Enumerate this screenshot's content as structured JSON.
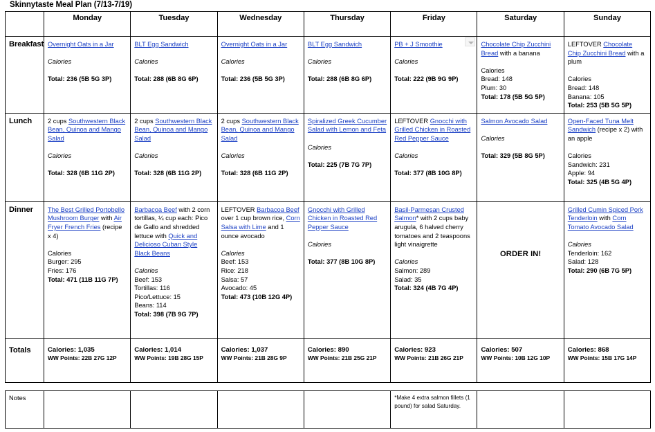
{
  "title": "Skinnytaste Meal Plan (7/13-7/19)",
  "days": [
    "Monday",
    "Tuesday",
    "Wednesday",
    "Thursday",
    "Friday",
    "Saturday",
    "Sunday"
  ],
  "row_labels": {
    "breakfast": "Breakfast",
    "lunch": "Lunch",
    "dinner": "Dinner",
    "totals": "Totals",
    "notes": "Notes"
  },
  "labels": {
    "calories": "Calories",
    "order_in": "ORDER IN!"
  },
  "colors": {
    "link": "#1a3fc4",
    "border": "#000000",
    "background": "#ffffff",
    "icon_gray": "#b4b4b4"
  },
  "icons": {
    "filter_dropdown": "chevron-down-icon"
  },
  "breakfast": {
    "monday": {
      "link": "Overnight Oats in a Jar",
      "after_link": "",
      "calories_label": "Calories",
      "items": [],
      "total": "Total: 236 (5B 5G 3P)"
    },
    "tuesday": {
      "link": "BLT Egg Sandwich",
      "after_link": "",
      "calories_label": "Calories",
      "items": [],
      "total": "Total: 288 (6B 8G 6P)"
    },
    "wednesday": {
      "link": "Overnight Oats in a Jar",
      "after_link": "",
      "calories_label": "Calories",
      "items": [],
      "total": "Total: 236 (5B 5G 3P)"
    },
    "thursday": {
      "link": "BLT Egg Sandwich",
      "after_link": "",
      "calories_label": "Calories",
      "items": [],
      "total": "Total: 288 (6B 8G 6P)"
    },
    "friday": {
      "link": "PB + J Smoothie",
      "after_link": "",
      "calories_label": "Calories",
      "items": [],
      "total": "Total: 222 (9B 9G 9P)"
    },
    "saturday": {
      "link": "Chocolate Chip Zucchini Bread",
      "after_link": " with a banana",
      "calories_label": "Calories",
      "items": [
        "Bread: 148",
        "Plum: 30"
      ],
      "total": "Total: 178 (5B 5G 5P)"
    },
    "sunday": {
      "prefix": "LEFTOVER ",
      "link": "Chocolate Chip Zucchini Bread",
      "after_link": " with a plum",
      "calories_label": "Calories",
      "items": [
        "Bread: 148",
        "Banana: 105"
      ],
      "total": "Total: 253 (5B 5G 5P)"
    }
  },
  "lunch": {
    "monday": {
      "prefix": "2 cups ",
      "link": "Southwestern Black Bean, Quinoa and Mango Salad",
      "after_link": "",
      "calories_label": "Calories",
      "items": [],
      "total": "Total: 328 (6B 11G 2P)"
    },
    "tuesday": {
      "prefix": "2 cups ",
      "link": "Southwestern Black Bean, Quinoa and Mango Salad",
      "after_link": "",
      "calories_label": "Calories",
      "items": [],
      "total": "Total: 328 (6B 11G 2P)"
    },
    "wednesday": {
      "prefix": "2 cups ",
      "link": "Southwestern Black Bean, Quinoa and Mango Salad",
      "after_link": "",
      "calories_label": "Calories",
      "items": [],
      "total": "Total: 328 (6B 11G 2P)"
    },
    "thursday": {
      "prefix": "",
      "link": "Spiralized Greek Cucumber Salad with Lemon and Feta",
      "after_link": "",
      "calories_label": "Calories",
      "items": [],
      "total": "Total: 225 (7B 7G 7P)"
    },
    "friday": {
      "prefix": "LEFTOVER ",
      "link": "Gnocchi with Grilled Chicken in Roasted Red Pepper Sauce",
      "after_link": "",
      "calories_label": "Calories",
      "items": [],
      "total": "Total: 377 (8B 10G 8P)"
    },
    "saturday": {
      "prefix": "",
      "link": "Salmon Avocado Salad",
      "after_link": "",
      "calories_label": "Calories",
      "items": [],
      "total": "Total: 329 (5B 8G 5P)"
    },
    "sunday": {
      "prefix": "",
      "link": "Open-Faced Tuna Melt Sandwich",
      "after_link": " (recipe x 2) with an apple",
      "calories_label": "Calories",
      "items": [
        "Sandwich: 231",
        "Apple: 94"
      ],
      "total": "Total: 325 (4B 5G 4P)"
    }
  },
  "dinner": {
    "monday": {
      "segments": [
        {
          "t": "link",
          "v": "The Best Grilled Portobello Mushroom Burger"
        },
        {
          "t": "text",
          "v": " with "
        },
        {
          "t": "link",
          "v": "Air Fryer French Fries"
        },
        {
          "t": "text",
          "v": " (recipe x 4)"
        }
      ],
      "calories_label": "Calories",
      "calories_italic": false,
      "items": [
        "Burger: 295",
        "Fries: 176"
      ],
      "total": "Total: 471 (11B 11G 7P)"
    },
    "tuesday": {
      "segments": [
        {
          "t": "link",
          "v": "Barbacoa Beef"
        },
        {
          "t": "text",
          "v": " with 2 corn tortillas, ¼ cup each: Pico de Gallo and shredded lettuce with "
        },
        {
          "t": "link",
          "v": "Quick and Delicioso Cuban Style Black Beans"
        }
      ],
      "calories_label": "Calories",
      "calories_italic": true,
      "items": [
        "Beef: 153",
        "Tortillas: 116",
        "Pico/Lettuce: 15",
        "Beans: 114"
      ],
      "total": "Total: 398 (7B 9G 7P)"
    },
    "wednesday": {
      "segments": [
        {
          "t": "text",
          "v": "LEFTOVER "
        },
        {
          "t": "link",
          "v": "Barbacoa Beef"
        },
        {
          "t": "text",
          "v": " over 1 cup brown rice, "
        },
        {
          "t": "link",
          "v": "Corn Salsa with Lime"
        },
        {
          "t": "text",
          "v": " and 1 ounce avocado"
        }
      ],
      "calories_label": "Calories",
      "calories_italic": true,
      "items": [
        "Beef: 153",
        "Rice: 218",
        "Salsa: 57",
        "Avocado: 45"
      ],
      "total": "Total: 473 (10B 12G 4P)"
    },
    "thursday": {
      "segments": [
        {
          "t": "link",
          "v": "Gnocchi with Grilled Chicken in Roasted Red Pepper Sauce"
        }
      ],
      "calories_label": "Calories",
      "calories_italic": true,
      "items": [],
      "total": "Total: 377 (8B 10G 8P)"
    },
    "friday": {
      "segments": [
        {
          "t": "link",
          "v": "Basil-Parmesan Crusted Salmon"
        },
        {
          "t": "text",
          "v": "* with 2 cups baby arugula, 6 halved cherry tomatoes and 2 teaspoons light vinaigrette"
        }
      ],
      "calories_label": "Calories",
      "calories_italic": true,
      "items": [
        "Salmon: 289",
        "Salad: 35"
      ],
      "total": "Total: 324 (4B 7G 4P)"
    },
    "saturday": {
      "order_in": "ORDER IN!"
    },
    "sunday": {
      "segments": [
        {
          "t": "link",
          "v": "Grilled Cumin Spiced Pork Tenderloin"
        },
        {
          "t": "text",
          "v": " with "
        },
        {
          "t": "link",
          "v": "Corn Tomato Avocado Salad"
        }
      ],
      "calories_label": "Calories",
      "calories_italic": true,
      "items": [
        "Tenderloin: 162",
        "Salad: 128"
      ],
      "total": "Total: 290 (6B 7G 5P)"
    }
  },
  "totals": {
    "monday": {
      "calories": "Calories: 1,035",
      "ww": "WW Points: 22B 27G 12P"
    },
    "tuesday": {
      "calories": "Calories: 1,014",
      "ww": "WW Points: 19B 28G 15P"
    },
    "wednesday": {
      "calories": "Calories: 1,037",
      "ww": "WW Points: 21B 28G 9P"
    },
    "thursday": {
      "calories": "Calories: 890",
      "ww": "WW Points: 21B 25G 21P"
    },
    "friday": {
      "calories": "Calories: 923",
      "ww": "WW Points: 21B 26G 21P"
    },
    "saturday": {
      "calories": "Calories: 507",
      "ww": "WW Points: 10B 12G 10P"
    },
    "sunday": {
      "calories": "Calories: 868",
      "ww": "WW Points: 15B 17G 14P"
    }
  },
  "notes": {
    "monday": "",
    "tuesday": "",
    "wednesday": "",
    "thursday": "",
    "friday": "*Make 4 extra salmon fillets (1 pound) for salad Saturday.",
    "saturday": "",
    "sunday": ""
  }
}
